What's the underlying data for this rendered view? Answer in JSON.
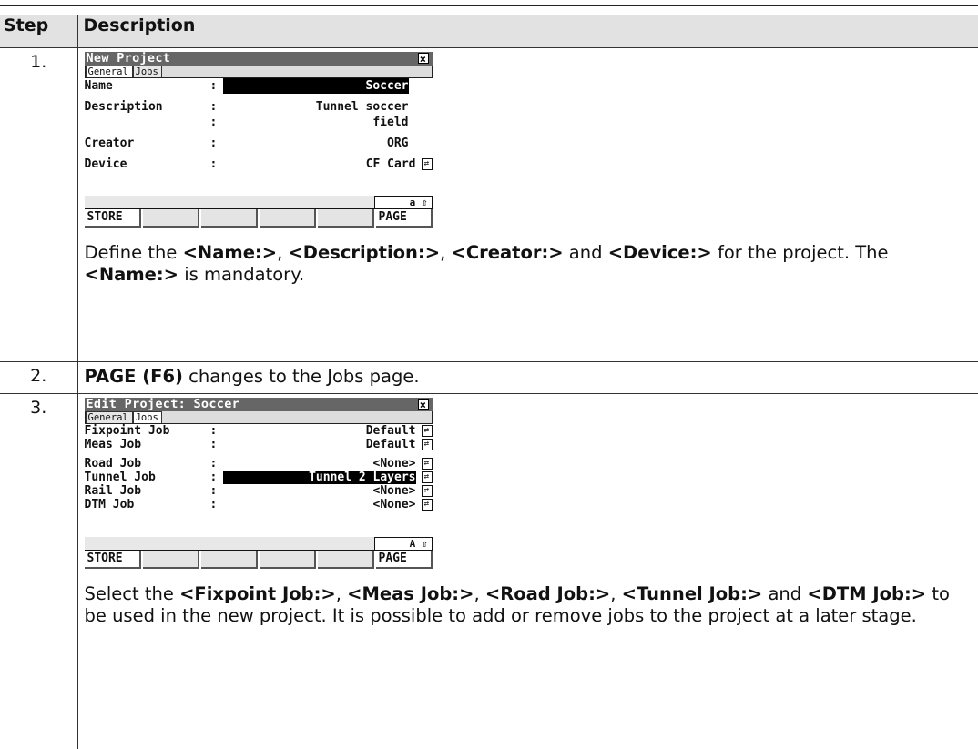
{
  "table": {
    "header": {
      "step": "Step",
      "description": "Description"
    },
    "rows": [
      {
        "step": "1.",
        "screen": {
          "title": "New Project",
          "close": "×",
          "tabs": [
            "General",
            "Jobs"
          ],
          "fields": [
            {
              "label": "Name",
              "colon": ":",
              "value": "Soccer"
            },
            {
              "label": "Description",
              "colon": ":",
              "value": "Tunnel soccer"
            },
            {
              "label": "",
              "colon": ":",
              "value": "field"
            },
            {
              "label": "Creator",
              "colon": ":",
              "value": "ORG"
            },
            {
              "label": "Device",
              "colon": ":",
              "value": "CF Card"
            }
          ],
          "mode": "a ⇧",
          "fkeys": [
            "STORE",
            "",
            "",
            "",
            "",
            "PAGE"
          ]
        },
        "text": {
          "p1": "Define the ",
          "b1": "<Name:>",
          "p2": ", ",
          "b2": "<Description:>",
          "p3": ", ",
          "b3": "<Creator:>",
          "p4": " and ",
          "b4": "<Device:>",
          "p5": " for the project. The ",
          "b5": "<Name:>",
          "p6": " is mandatory."
        }
      },
      {
        "step": "2.",
        "text": {
          "b1": "PAGE (F6)",
          "p1": " changes to the Jobs page."
        }
      },
      {
        "step": "3.",
        "screen": {
          "title": "Edit Project: Soccer",
          "close": "×",
          "tabs": [
            "General",
            "Jobs"
          ],
          "fields": [
            {
              "label": "Fixpoint Job",
              "colon": ":",
              "value": "Default"
            },
            {
              "label": "Meas Job",
              "colon": ":",
              "value": "Default"
            },
            {
              "label": "Road Job",
              "colon": ":",
              "value": "<None>"
            },
            {
              "label": "Tunnel Job",
              "colon": ":",
              "value": "Tunnel 2 Layers"
            },
            {
              "label": "Rail Job",
              "colon": ":",
              "value": "<None>"
            },
            {
              "label": "DTM Job",
              "colon": ":",
              "value": "<None>"
            }
          ],
          "mode": "A ⇧",
          "fkeys": [
            "STORE",
            "",
            "",
            "",
            "",
            "PAGE"
          ]
        },
        "text": {
          "p1": "Select the ",
          "b1": "<Fixpoint Job:>",
          "p2": ", ",
          "b2": "<Meas Job:>",
          "p3": ", ",
          "b3": "<Road Job:>",
          "p4": ", ",
          "b4": "<Tunnel Job:>",
          "p5": " and ",
          "b5": "<DTM Job:>",
          "p6": " to be used in the new project. It is possible to add or remove jobs to the project at a later stage."
        }
      }
    ]
  },
  "icons": {
    "arrow": "⇄"
  }
}
